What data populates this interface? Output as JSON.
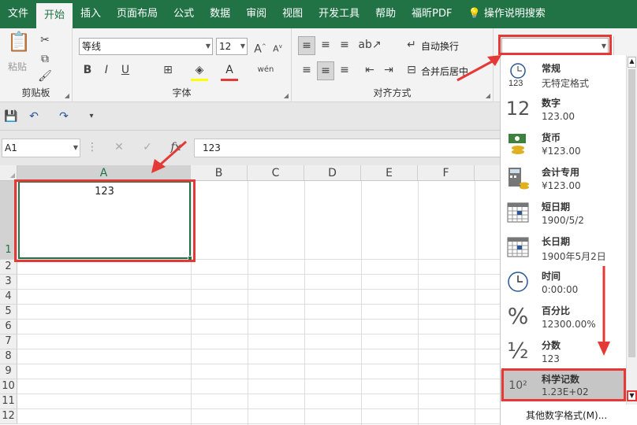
{
  "tabs": [
    "文件",
    "开始",
    "插入",
    "页面布局",
    "公式",
    "数据",
    "审阅",
    "视图",
    "开发工具",
    "帮助",
    "福昕PDF",
    "操作说明搜索"
  ],
  "ribbon": {
    "clipboard": {
      "paste": "粘贴",
      "label": "剪贴板"
    },
    "font": {
      "name": "等线",
      "size": "12",
      "bold": "B",
      "italic": "I",
      "underline": "U",
      "label": "字体"
    },
    "align": {
      "wrap": "自动换行",
      "merge": "合并后居中",
      "label": "对齐方式"
    },
    "number": {
      "format_value": ""
    }
  },
  "formula_bar": {
    "name_box": "A1",
    "fx": "fx",
    "content": "123"
  },
  "grid": {
    "columns": [
      "A",
      "B",
      "C",
      "D",
      "E",
      "F"
    ],
    "rows": [
      "1",
      "2",
      "3",
      "4",
      "5",
      "6",
      "7",
      "8",
      "9",
      "10",
      "11",
      "12"
    ],
    "a1": "123"
  },
  "formats": [
    {
      "name": "常规",
      "sample": "无特定格式",
      "icon": "clock-123-icon"
    },
    {
      "name": "数字",
      "sample": "123.00",
      "icon": "number-12-icon"
    },
    {
      "name": "货币",
      "sample": "¥123.00",
      "icon": "currency-icon"
    },
    {
      "name": "会计专用",
      "sample": " ¥123.00",
      "icon": "accounting-icon"
    },
    {
      "name": "短日期",
      "sample": "1900/5/2",
      "icon": "calendar-icon"
    },
    {
      "name": "长日期",
      "sample": "1900年5月2日",
      "icon": "calendar-icon"
    },
    {
      "name": "时间",
      "sample": "0:00:00",
      "icon": "clock-icon"
    },
    {
      "name": "百分比",
      "sample": "12300.00%",
      "icon": "percent-icon"
    },
    {
      "name": "分数",
      "sample": "123",
      "icon": "fraction-icon"
    },
    {
      "name": "科学记数",
      "sample": "1.23E+02",
      "icon": "scientific-icon"
    }
  ],
  "more_formats": "其他数字格式(M)...",
  "colors": {
    "accent": "#217346",
    "highlight": "#e53935"
  }
}
